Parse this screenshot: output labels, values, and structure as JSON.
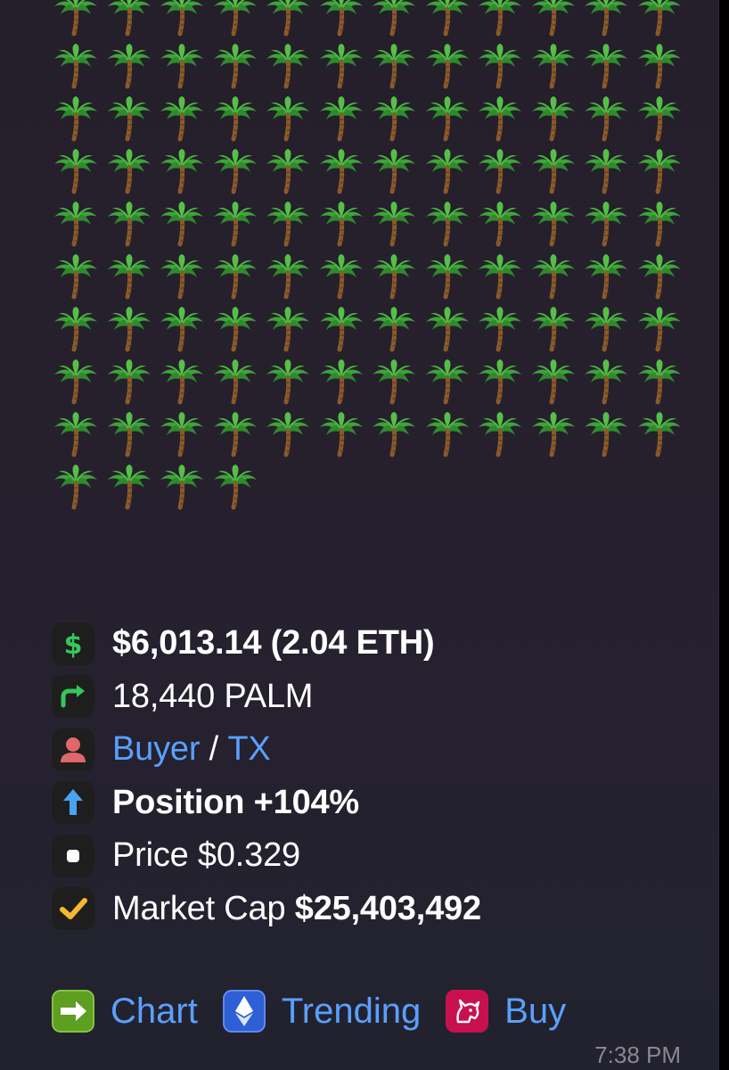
{
  "message": {
    "palm_emoji_count": 112,
    "palm_icon": "palm-tree-emoji",
    "lines": [
      {
        "icon": "dollar-icon",
        "text": "$6,013.14 (2.04 ETH)"
      },
      {
        "icon": "share-arrow-icon",
        "text": "18,440 PALM"
      },
      {
        "icon": "person-icon",
        "buyer": "Buyer",
        "separator": "/",
        "tx": "TX"
      },
      {
        "icon": "up-arrow-icon",
        "text": "Position +104%"
      },
      {
        "icon": "record-button-icon",
        "text": "Price $0.329"
      },
      {
        "icon": "checkmark-icon",
        "label": "Market Cap",
        "value": "$25,403,492"
      }
    ],
    "buttons": [
      {
        "icon": "right-arrow-icon",
        "label": "Chart"
      },
      {
        "icon": "ethereum-icon",
        "label": "Trending"
      },
      {
        "icon": "unicorn-icon",
        "label": "Buy"
      }
    ],
    "time": "7:38 PM"
  },
  "colors": {
    "link": "#5aa0ff",
    "background": "#25212f",
    "text": "#ffffff"
  }
}
